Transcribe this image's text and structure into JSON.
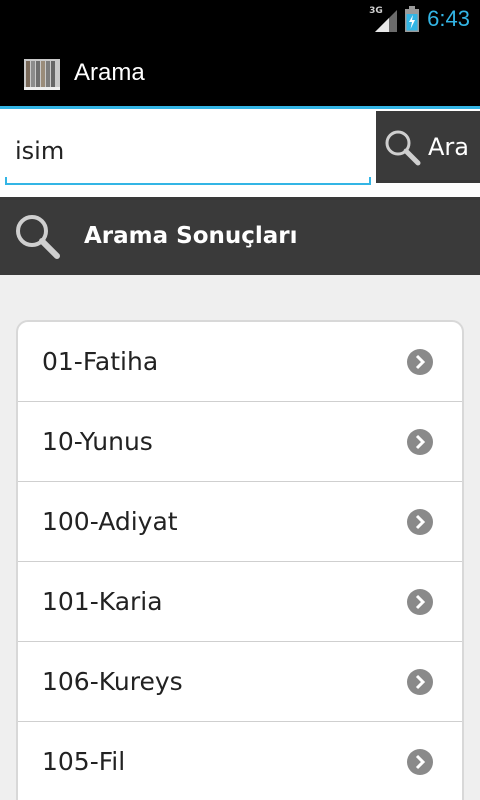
{
  "status_bar": {
    "network": "3G",
    "time": "6:43"
  },
  "action_bar": {
    "title": "Arama"
  },
  "search": {
    "value": "isim",
    "button_label": "Ara"
  },
  "results": {
    "header": "Arama Sonuçları",
    "items": [
      {
        "label": "01-Fatiha"
      },
      {
        "label": "10-Yunus"
      },
      {
        "label": "100-Adiyat"
      },
      {
        "label": "101-Karia"
      },
      {
        "label": "106-Kureys"
      },
      {
        "label": "105-Fil"
      }
    ]
  },
  "colors": {
    "accent": "#33b5e5",
    "dark_panel": "#3a3a3a",
    "background": "#efefef"
  }
}
